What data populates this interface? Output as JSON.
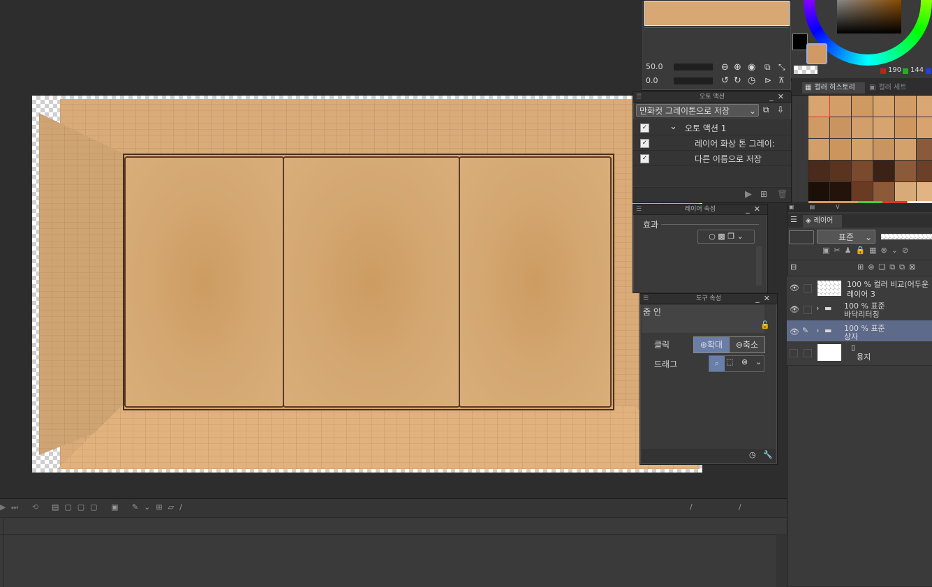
{
  "navigator": {
    "zoom": "50.0",
    "rotation": "0.0"
  },
  "color": {
    "main_hex": "#d29a63",
    "sub_hex": "#000000",
    "values": [
      "190",
      "144"
    ]
  },
  "color_tabs": {
    "history": "컬러 히스토리",
    "set": "컬러 세트"
  },
  "swatches": [
    "#d8a470",
    "#d49e68",
    "#cf9a62",
    "#d6a36d",
    "#d19c66",
    "#d9a774",
    "#cf9864",
    "#cf9a63",
    "#c99460",
    "#d29f6a",
    "#d6a46f",
    "#cd975f",
    "#d7a470",
    "#cc9660",
    "#d29e69",
    "#cb955d",
    "#d1a06b",
    "#c89460",
    "#d3a16b",
    "#8a5a3c",
    "#d0a068",
    "#4a2a1a",
    "#5a341f",
    "#7a4a2c",
    "#3c2216",
    "#8a5a3a",
    "#6a4028",
    "#2a160e",
    "#1c0f08",
    "#24130a",
    "#6a3a22",
    "#8c5a38",
    "#d8aa78",
    "#e2b484",
    "#f3c896"
  ],
  "auto_action": {
    "title": "오토 액션",
    "set_name": "만화컷 그레이톤으로 저장",
    "items": [
      {
        "label": "오토 액션 1",
        "checked": "✓"
      },
      {
        "label": "레이어 화상 톤 그레이:",
        "checked": "✓"
      },
      {
        "label": "다른 이름으로 저장",
        "checked": "✓"
      }
    ]
  },
  "layer_property": {
    "title": "레이어 속성",
    "effect_label": "효과"
  },
  "tool_property": {
    "title": "도구 속성",
    "tool_name": "줌 인",
    "click_label": "클릭",
    "zoom_in": "확대",
    "zoom_out": "축소",
    "drag_label": "드래그"
  },
  "layer_panel": {
    "tab": "레이어",
    "blend_mode": "표준",
    "layers": [
      {
        "opacity": "100 % 컬러 비교(어두운",
        "name": "레이어 3"
      },
      {
        "opacity": "100 % 표준",
        "name": "바닥리터칭"
      },
      {
        "opacity": "100 % 표준",
        "name": "상자"
      },
      {
        "opacity": "",
        "name": "용지"
      }
    ]
  },
  "timeline": {
    "sep1": "/",
    "sep2": "/"
  }
}
